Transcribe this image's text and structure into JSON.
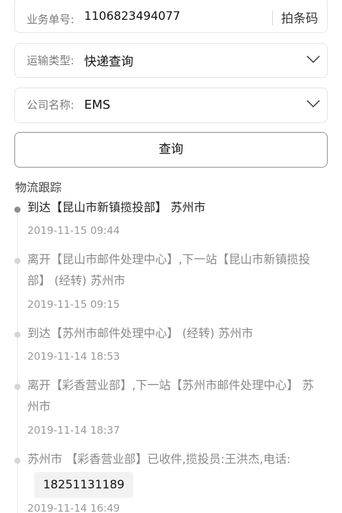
{
  "order": {
    "label": "业务单号:",
    "value": "1106823494077",
    "scan_label": "拍条码"
  },
  "transport": {
    "label": "运输类型:",
    "value": "快递查询"
  },
  "company": {
    "label": "公司名称:",
    "value": "EMS"
  },
  "query_button": "查询",
  "tracking": {
    "title": "物流跟踪",
    "events": [
      {
        "text": "到达【昆山市新镇揽投部】 苏州市",
        "time": "2019-11-15 09:44"
      },
      {
        "text": "离开【昆山市邮件处理中心】,下一站【昆山市新镇揽投部】 (经转) 苏州市",
        "time": "2019-11-15 09:15"
      },
      {
        "text": "到达【苏州市邮件处理中心】 (经转) 苏州市",
        "time": "2019-11-14 18:53"
      },
      {
        "text": "离开【彩香营业部】,下一站【苏州市邮件处理中心】 苏州市",
        "time": "2019-11-14 18:37"
      },
      {
        "text": "苏州市 【彩香营业部】已收件,揽投员:王洪杰,电话:",
        "phone": "18251131189",
        "time": "2019-11-14 16:49"
      }
    ]
  }
}
